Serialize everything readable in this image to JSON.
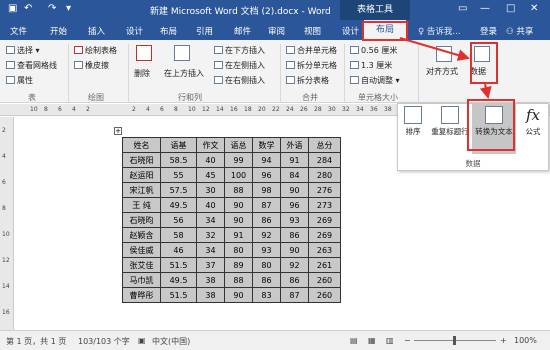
{
  "titlebar": {
    "save_icon": "save-icon",
    "undo_icon": "undo-icon",
    "redo_icon": "redo-icon",
    "dropdown": "▾",
    "doc_title": "新建 Microsoft Word 文档 (2).docx - Word",
    "tools_title": "表格工具",
    "min": "—",
    "restore": "□",
    "close": "✕"
  },
  "tabs": [
    "文件",
    "开始",
    "插入",
    "设计",
    "布局",
    "引用",
    "邮件",
    "审阅",
    "视图",
    "设计",
    "布局"
  ],
  "tell": "♀ 告诉我...",
  "login": "登录",
  "share": "共享",
  "ribbon": {
    "select": "选择",
    "gridlines": "查看网格线",
    "props": "属性",
    "g_table": "表",
    "draw": "绘制表格",
    "eraser": "橡皮擦",
    "g_draw": "绘图",
    "delete": "删除",
    "insert_above": "在上方插入",
    "insert_below": "在下方插入",
    "insert_left": "在左侧插入",
    "insert_right": "在右侧插入",
    "g_rowcol": "行和列",
    "merge": "合并单元格",
    "split_cells": "拆分单元格",
    "split_table": "拆分表格",
    "g_merge": "合并",
    "height": "0.56 厘米",
    "width": "1.3 厘米",
    "autofit": "自动调整",
    "g_cellsize": "单元格大小",
    "align": "对齐方式",
    "data": "数据"
  },
  "ruler": [
    "10",
    "8",
    "6",
    "4",
    "2",
    "2",
    "4",
    "6",
    "8",
    "10",
    "12",
    "14",
    "16",
    "18",
    "20",
    "22",
    "24",
    "26",
    "28",
    "30",
    "32",
    "34",
    "36",
    "38"
  ],
  "vruler": [
    "2",
    "4",
    "6",
    "8",
    "10",
    "12",
    "14",
    "16"
  ],
  "table": {
    "rows": [
      [
        "姓名",
        "语基",
        "作文",
        "语总",
        "数学",
        "外语",
        "总分"
      ],
      [
        "石晓阳",
        "58.5",
        "40",
        "99",
        "94",
        "91",
        "284"
      ],
      [
        "赵运阳",
        "55",
        "45",
        "100",
        "96",
        "84",
        "280"
      ],
      [
        "宋江帆",
        "57.5",
        "30",
        "88",
        "98",
        "90",
        "276"
      ],
      [
        "王  纯",
        "49.5",
        "40",
        "90",
        "87",
        "96",
        "273"
      ],
      [
        "石晓昀",
        "56",
        "34",
        "90",
        "86",
        "93",
        "269"
      ],
      [
        "赵颖含",
        "58",
        "32",
        "91",
        "92",
        "86",
        "269"
      ],
      [
        "侯佳威",
        "46",
        "34",
        "80",
        "93",
        "90",
        "263"
      ],
      [
        "张艾佳",
        "51.5",
        "37",
        "89",
        "80",
        "92",
        "261"
      ],
      [
        "马巾凯",
        "49.5",
        "38",
        "88",
        "86",
        "86",
        "260"
      ],
      [
        "曹晔彤",
        "51.5",
        "38",
        "90",
        "83",
        "87",
        "260"
      ]
    ]
  },
  "status": {
    "page": "第 1 页，共 1 页",
    "words": "103/103 个字",
    "lang": "中文(中国)",
    "zoom": "100%",
    "plus": "+",
    "minus": "−"
  },
  "popup": {
    "sort": "排序",
    "repeat": "重复标题行",
    "convert": "转换为文本",
    "formula": "公式",
    "group": "数据"
  },
  "colors": {
    "accent": "#2b579a",
    "highlight": "#e03030"
  }
}
